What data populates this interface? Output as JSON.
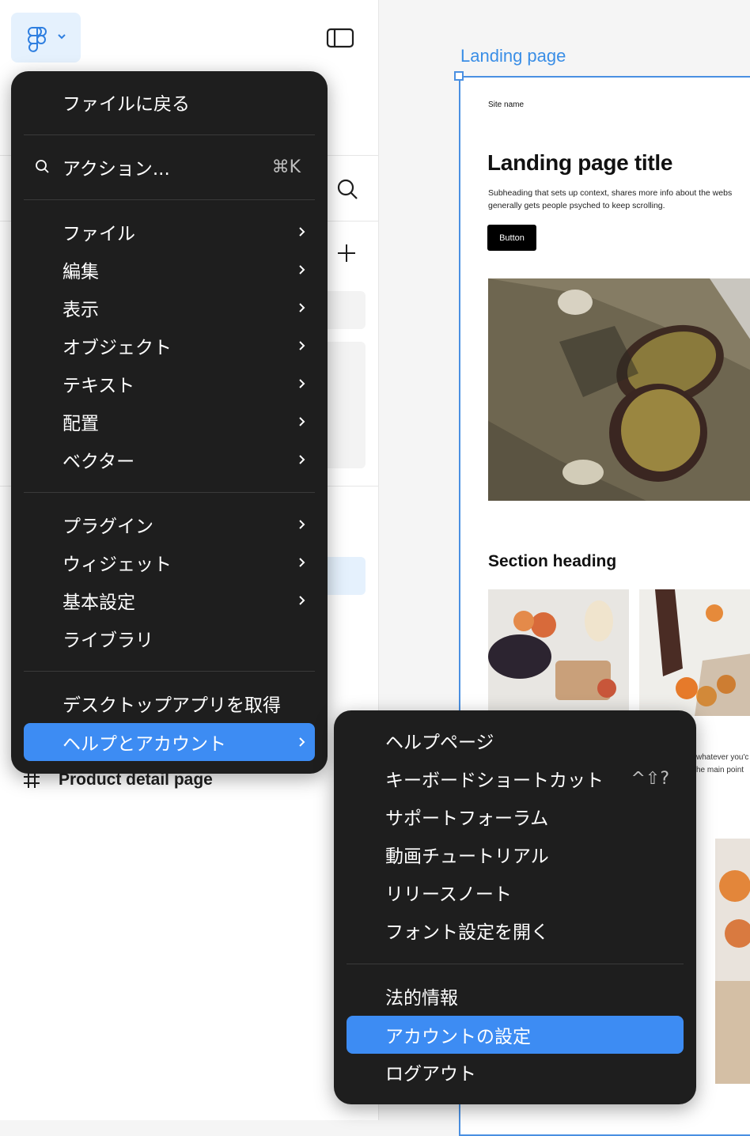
{
  "colors": {
    "accent": "#3d8cf3",
    "menu_bg": "#1e1e1e",
    "frame_selection": "#4a90e2"
  },
  "sidebar": {
    "logo_icon": "figma-logo-icon",
    "toggle_icon": "sidebar-toggle-icon",
    "page_item": {
      "icon": "frame-hash-icon",
      "label": "Product detail page"
    }
  },
  "main_menu": {
    "back_to_files": "ファイルに戻る",
    "actions": {
      "label": "アクション...",
      "shortcut": "⌘K"
    },
    "items_group1": [
      {
        "label": "ファイル"
      },
      {
        "label": "編集"
      },
      {
        "label": "表示"
      },
      {
        "label": "オブジェクト"
      },
      {
        "label": "テキスト"
      },
      {
        "label": "配置"
      },
      {
        "label": "ベクター"
      }
    ],
    "items_group2": [
      {
        "label": "プラグイン"
      },
      {
        "label": "ウィジェット"
      },
      {
        "label": "基本設定"
      },
      {
        "label": "ライブラリ"
      }
    ],
    "get_desktop_app": "デスクトップアプリを取得",
    "help_account": "ヘルプとアカウント"
  },
  "sub_menu": {
    "help_page": "ヘルプページ",
    "keyboard_shortcuts": {
      "label": "キーボードショートカット",
      "shortcut": "^⇧?"
    },
    "support_forum": "サポートフォーラム",
    "video_tutorials": "動画チュートリアル",
    "release_notes": "リリースノート",
    "open_font_settings": "フォント設定を開く",
    "legal": "法的情報",
    "account_settings": "アカウントの設定",
    "logout": "ログアウト"
  },
  "canvas": {
    "frame_label": "Landing page",
    "site_name": "Site name",
    "title": "Landing page title",
    "subheading_line1": "Subheading that sets up context, shares more info about the webs",
    "subheading_line2": "generally gets people psyched to keep scrolling.",
    "button_label": "Button",
    "section_heading": "Section heading",
    "snippet1": "whatever you'c",
    "snippet2": "he main point"
  }
}
